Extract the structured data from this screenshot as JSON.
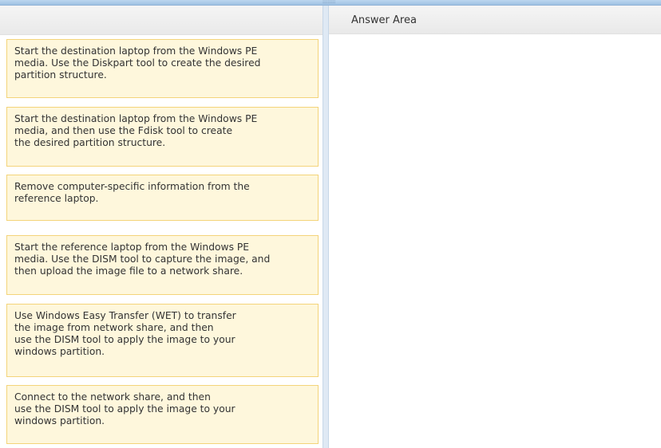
{
  "splitter": {
    "grip": "::::::::"
  },
  "answer_area": {
    "title": "Answer Area"
  },
  "options": [
    {
      "text": "Start the destination laptop from the Windows PE\nmedia. Use the Diskpart tool to create the desired\npartition structure."
    },
    {
      "text": "Start the destination laptop from the Windows PE\nmedia, and then use the Fdisk tool to create\nthe desired partition structure."
    },
    {
      "text": "Remove computer-specific information from the\nreference laptop."
    },
    {
      "text": "Start the reference laptop from the Windows PE\nmedia. Use the DISM tool to capture the image, and\nthen upload the image file to a network share."
    },
    {
      "text": "Use Windows Easy Transfer (WET) to transfer\nthe image from network share, and then\nuse the DISM tool to apply the image to your\nwindows partition."
    },
    {
      "text": "Connect to the network share, and then\nuse the DISM tool to apply the image to your\nwindows partition."
    }
  ]
}
